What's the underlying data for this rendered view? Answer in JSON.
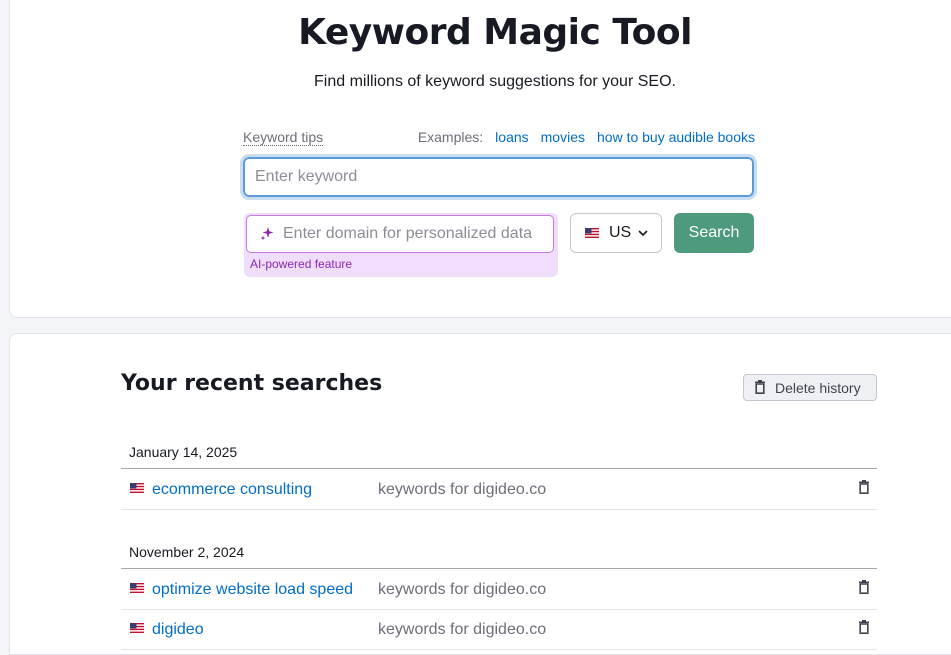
{
  "header": {
    "title": "Keyword Magic Tool",
    "subtitle": "Find millions of keyword suggestions for your SEO."
  },
  "search": {
    "tips_label": "Keyword tips",
    "examples_label": "Examples:",
    "examples": [
      "loans",
      "movies",
      "how to buy audible books"
    ],
    "keyword_placeholder": "Enter keyword",
    "domain_placeholder": "Enter domain for personalized data",
    "ai_label": "AI-powered feature",
    "country": "US",
    "search_label": "Search"
  },
  "recent": {
    "title": "Your recent searches",
    "delete_label": "Delete history",
    "groups": [
      {
        "date": "January 14, 2025",
        "items": [
          {
            "keyword": "ecommerce consulting",
            "desc": "keywords for digideo.co"
          }
        ]
      },
      {
        "date": "November 2, 2024",
        "items": [
          {
            "keyword": "optimize website load speed",
            "desc": "keywords for digideo.co"
          },
          {
            "keyword": "digideo",
            "desc": "keywords for digideo.co"
          }
        ]
      }
    ]
  },
  "colors": {
    "primary_button": "#4e9a7c",
    "link": "#006dca",
    "ai_accent": "#8a2ab3"
  }
}
